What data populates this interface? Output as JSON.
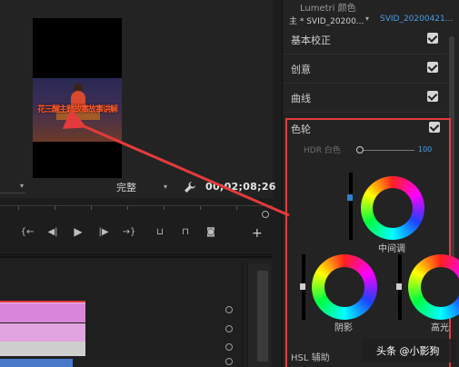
{
  "monitor": {
    "video_caption": "花三醒主题故事故事讲解",
    "quality": "完整",
    "timecode": "00;02;08;26"
  },
  "transport": {
    "mark_in": "{←",
    "step_back": "◀|",
    "play": "▶",
    "step_forward": "|▶",
    "mark_out": "→}",
    "lift": "⊔",
    "extract": "⊓",
    "camera": "◙",
    "add": "+"
  },
  "lumetri": {
    "title": "Lumetri 颜色",
    "master_clip": "主 * SVID_20200...",
    "clip_target": "SVID_20200421...",
    "sections": [
      {
        "label": "基本校正",
        "checked": true
      },
      {
        "label": "创意",
        "checked": true
      },
      {
        "label": "曲线",
        "checked": true
      }
    ],
    "color_wheels": {
      "label": "色轮",
      "checked": true,
      "hdr_label": "HDR 白色",
      "hdr_value": "100",
      "midtones": "中间调",
      "shadows": "阴影",
      "highlights": "高光"
    },
    "hsl_label": "HSL 辅助"
  },
  "watermark": "头条 @小影狗",
  "colors": {
    "annotation_red": "#e33b3b",
    "accent_blue": "#4a9fe8",
    "track_pink": "#d985d9"
  }
}
